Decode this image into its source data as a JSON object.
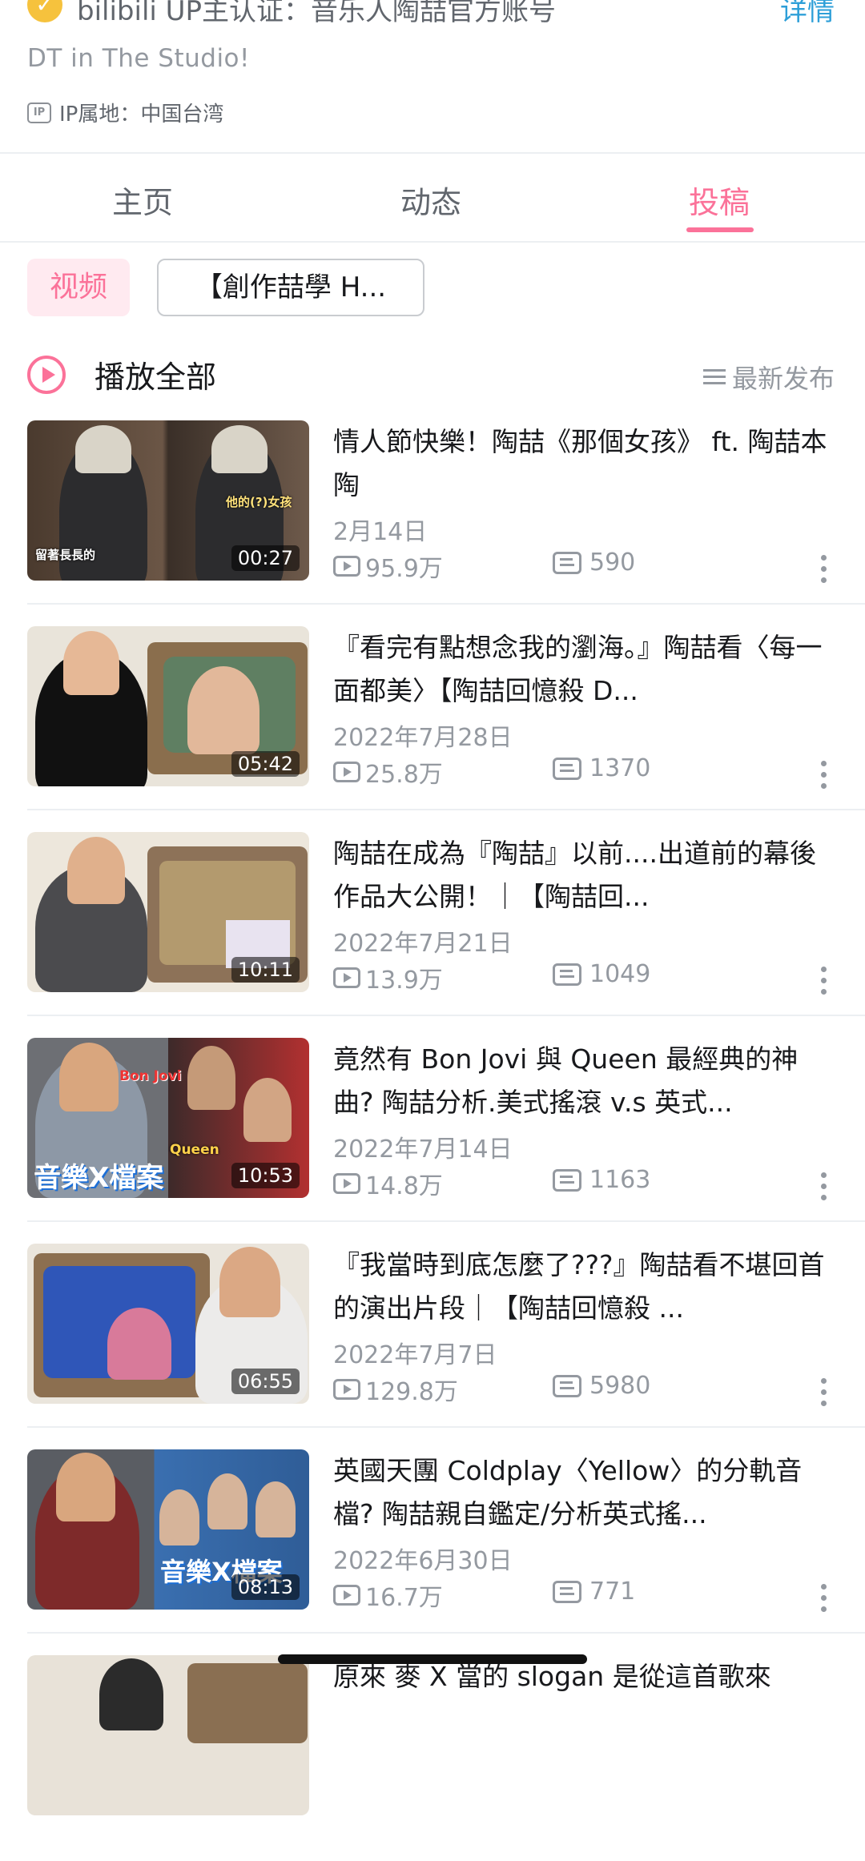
{
  "header": {
    "cert_text": "bilibili UP主认证：音乐人陶喆官方账号",
    "detail_link": "详情",
    "bio": "DT in The Studio!",
    "ip_badge": "IP",
    "ip_location": "IP属地：中国台湾"
  },
  "tabs": [
    {
      "label": "主页"
    },
    {
      "label": "动态"
    },
    {
      "label": "投稿"
    }
  ],
  "filters": {
    "video": "视频",
    "series": "【創作喆學 H..."
  },
  "play_all": {
    "label": "播放全部",
    "sort_label": "最新发布"
  },
  "videos": [
    {
      "title": "情人節快樂！陶喆《那個女孩》 ft. 陶喆本陶",
      "date": "2月14日",
      "views": "95.9万",
      "danmaku": "590",
      "duration": "00:27",
      "thumb_text": "留著長長的",
      "thumb_text2": "他的(?)女孩"
    },
    {
      "title": "『看完有點想念我的瀏海。』陶喆看〈每一面都美〉【陶喆回憶殺 D...",
      "date": "2022年7月28日",
      "views": "25.8万",
      "danmaku": "1370",
      "duration": "05:42"
    },
    {
      "title": "陶喆在成為『陶喆』以前....出道前的幕後作品大公開！｜【陶喆回...",
      "date": "2022年7月21日",
      "views": "13.9万",
      "danmaku": "1049",
      "duration": "10:11"
    },
    {
      "title": "竟然有 Bon Jovi 與 Queen 最經典的神曲? 陶喆分析.美式搖滾 v.s 英式...",
      "date": "2022年7月14日",
      "views": "14.8万",
      "danmaku": "1163",
      "duration": "10:53",
      "thumb_text": "音樂X檔案",
      "thumb_text2": "Bon Jovi",
      "thumb_text3": "Queen"
    },
    {
      "title": "『我當時到底怎麼了???』陶喆看不堪回首的演出片段｜【陶喆回憶殺 ...",
      "date": "2022年7月7日",
      "views": "129.8万",
      "danmaku": "5980",
      "duration": "06:55"
    },
    {
      "title": "英國天團 Coldplay〈Yellow〉的分軌音檔? 陶喆親自鑑定/分析英式搖...",
      "date": "2022年6月30日",
      "views": "16.7万",
      "danmaku": "771",
      "duration": "08:13",
      "thumb_text": "音樂X檔案"
    },
    {
      "title": "原來 麥 X 當的 slogan 是從這首歌來",
      "date": "",
      "views": "",
      "danmaku": "",
      "duration": ""
    }
  ],
  "colors": {
    "accent": "#fb7299",
    "muted": "#9499a0",
    "link": "#2e9fd8"
  }
}
